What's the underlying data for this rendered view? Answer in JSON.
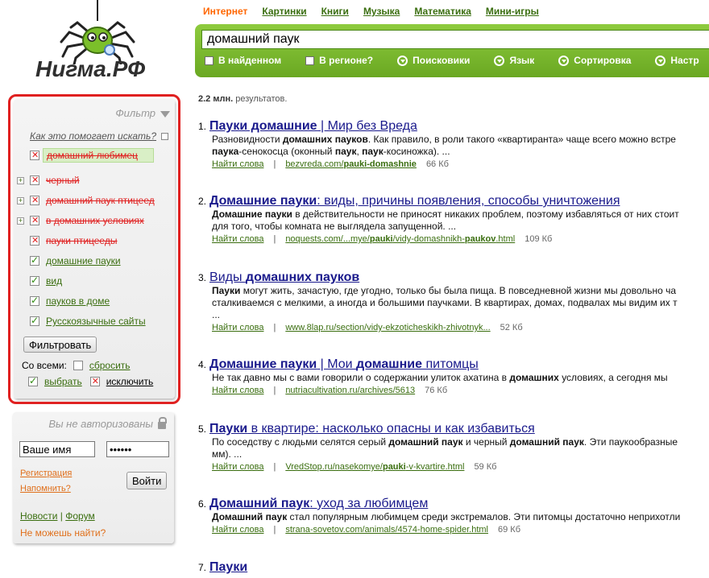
{
  "logo": {
    "text": "Нигма.РФ"
  },
  "nav": {
    "items": [
      "Интернет",
      "Картинки",
      "Книги",
      "Музыка",
      "Математика",
      "Мини-игры"
    ],
    "active_index": 0
  },
  "search": {
    "value": "домашний паук",
    "options": [
      {
        "label": "В найденном",
        "kind": "checkbox"
      },
      {
        "label": "В регионе?",
        "kind": "checkbox"
      },
      {
        "label": "Поисковики",
        "kind": "dropdown"
      },
      {
        "label": "Язык",
        "kind": "dropdown"
      },
      {
        "label": "Сортировка",
        "kind": "dropdown"
      },
      {
        "label": "Настр",
        "kind": "dropdown"
      }
    ]
  },
  "filter": {
    "title": "Фильтр",
    "help": "Как это помогает искать?",
    "items": [
      {
        "label": "домашний любимец",
        "state": "excluded",
        "expand": false,
        "highlight": true
      },
      {
        "label": "черный",
        "state": "excluded",
        "expand": true
      },
      {
        "label": "домашний паук птицеед",
        "state": "excluded",
        "expand": true
      },
      {
        "label": "в домашних условиях",
        "state": "excluded",
        "expand": true
      },
      {
        "label": "пауки птицееды",
        "state": "excluded",
        "expand": false
      },
      {
        "label": "домашние пауки",
        "state": "included",
        "expand": false
      },
      {
        "label": "вид",
        "state": "included",
        "expand": false
      },
      {
        "label": "пауков в доме",
        "state": "included",
        "expand": false
      },
      {
        "label": "Русскоязычные сайты",
        "state": "included",
        "expand": false
      }
    ],
    "button": "Фильтровать",
    "with_all": "Со всеми:",
    "reset": "сбросить",
    "select": "выбрать",
    "exclude": "исключить"
  },
  "login": {
    "title": "Вы не авторизованы",
    "name_value": "Ваше имя",
    "password_value": "••••••",
    "register": "Регистрация",
    "remind": "Напомнить?",
    "button": "Войти",
    "news": "Новости",
    "forum": "Форум",
    "cant_find": "Не можешь найти?"
  },
  "results_count": {
    "bold": "2.2 млн.",
    "rest": " результатов."
  },
  "results": [
    {
      "num": "1.",
      "title_parts": [
        {
          "t": "Пауки домашние",
          "b": true
        },
        {
          "t": " | Мир без Вреда",
          "b": false
        }
      ],
      "snippet": [
        [
          {
            "t": "Разновидности ",
            "b": false
          },
          {
            "t": "домашних пауков",
            "b": true
          },
          {
            "t": ". Как правило, в роли такого «квартиранта» чаще всего можно встре",
            "b": false
          }
        ],
        [
          {
            "t": "паука",
            "b": true
          },
          {
            "t": "-сенокосца (оконный ",
            "b": false
          },
          {
            "t": "паук",
            "b": true
          },
          {
            "t": ", ",
            "b": false
          },
          {
            "t": "паук",
            "b": true
          },
          {
            "t": "-косиножка). ...",
            "b": false
          }
        ]
      ],
      "find": "Найти слова",
      "url_parts": [
        {
          "t": "bezvreda.com/",
          "b": false
        },
        {
          "t": "pauki-domashnie",
          "b": true
        }
      ],
      "size": "66 Кб"
    },
    {
      "num": "2.",
      "title_parts": [
        {
          "t": "Домашние пауки",
          "b": true
        },
        {
          "t": ": виды, причины появления, способы уничтожения",
          "b": false
        }
      ],
      "snippet": [
        [
          {
            "t": "Домашние пауки",
            "b": true
          },
          {
            "t": " в действительности не приносят никаких проблем, поэтому избавляться от них стоит",
            "b": false
          }
        ],
        [
          {
            "t": "для того, чтобы комната не выглядела запущенной. ...",
            "b": false
          }
        ]
      ],
      "find": "Найти слова",
      "url_parts": [
        {
          "t": "noquests.com/...mye/",
          "b": false
        },
        {
          "t": "pauki",
          "b": true
        },
        {
          "t": "/vidy-domashnikh-",
          "b": false
        },
        {
          "t": "paukov",
          "b": true
        },
        {
          "t": ".html",
          "b": false
        }
      ],
      "size": "109 Кб"
    },
    {
      "num": "3.",
      "title_parts": [
        {
          "t": "Виды ",
          "b": false
        },
        {
          "t": "домашних пауков",
          "b": true
        }
      ],
      "snippet": [
        [
          {
            "t": "Пауки",
            "b": true
          },
          {
            "t": " могут жить, зачастую, где угодно, только бы была пища. В повседневной жизни мы довольно ча",
            "b": false
          }
        ],
        [
          {
            "t": "сталкиваемся с мелкими, а иногда и большими паучками. В квартирах, домах, подвалах мы видим их т",
            "b": false
          }
        ],
        [
          {
            "t": "...",
            "b": false
          }
        ]
      ],
      "find": "Найти слова",
      "url_parts": [
        {
          "t": "www.8lap.ru/section/vidy-ekzoticheskikh-zhivotnyk...",
          "b": false
        }
      ],
      "size": "52 Кб"
    },
    {
      "num": "4.",
      "title_parts": [
        {
          "t": "Домашние пауки",
          "b": true
        },
        {
          "t": " | Мои ",
          "b": false
        },
        {
          "t": "домашние",
          "b": true
        },
        {
          "t": " питомцы",
          "b": false
        }
      ],
      "snippet": [
        [
          {
            "t": "Не так давно мы с вами говорили о содержании улиток ахатина в ",
            "b": false
          },
          {
            "t": "домашних",
            "b": true
          },
          {
            "t": " условиях, а сегодня мы",
            "b": false
          }
        ]
      ],
      "find": "Найти слова",
      "url_parts": [
        {
          "t": "nutriacultivation.ru/archives/5613",
          "b": false
        }
      ],
      "size": "76 Кб"
    },
    {
      "num": "5.",
      "title_parts": [
        {
          "t": "Пауки",
          "b": true
        },
        {
          "t": " в квартире: насколько опасны и как избавиться",
          "b": false
        }
      ],
      "snippet": [
        [
          {
            "t": "По соседству с людьми селятся серый ",
            "b": false
          },
          {
            "t": "домашний паук",
            "b": true
          },
          {
            "t": " и черный ",
            "b": false
          },
          {
            "t": "домашний паук",
            "b": true
          },
          {
            "t": ". Эти паукообразные",
            "b": false
          }
        ],
        [
          {
            "t": "мм). ...",
            "b": false
          }
        ]
      ],
      "find": "Найти слова",
      "url_parts": [
        {
          "t": "VredStop.ru/nasekomye/",
          "b": false
        },
        {
          "t": "pauki",
          "b": true
        },
        {
          "t": "-v-kvartire.html",
          "b": false
        }
      ],
      "size": "59 Кб"
    },
    {
      "num": "6.",
      "title_parts": [
        {
          "t": "Домашний паук",
          "b": true
        },
        {
          "t": ": уход за любимцем",
          "b": false
        }
      ],
      "snippet": [
        [
          {
            "t": "Домашний паук",
            "b": true
          },
          {
            "t": " стал популярным любимцем среди экстремалов. Эти питомцы достаточно неприхотли",
            "b": false
          }
        ]
      ],
      "find": "Найти слова",
      "url_parts": [
        {
          "t": "strana-sovetov.com/animals/4574-home-spider.html",
          "b": false
        }
      ],
      "size": "69 Кб"
    },
    {
      "num": "7.",
      "title_parts": [
        {
          "t": "Пауки",
          "b": true
        }
      ],
      "snippet": [],
      "find": "",
      "url_parts": [],
      "size": ""
    }
  ],
  "colors": {
    "accent_green": "#6aa822",
    "link_blue": "#1a1a8c",
    "exclude_red": "#e02020",
    "orange": "#ff6600"
  }
}
